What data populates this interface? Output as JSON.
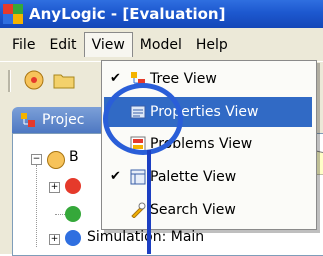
{
  "window": {
    "title": "AnyLogic - [Evaluation]"
  },
  "menubar": {
    "items": [
      "File",
      "Edit",
      "View",
      "Model",
      "Help"
    ],
    "active_index": 2
  },
  "panel": {
    "tab_label": "Projec"
  },
  "tree": {
    "root_label": "B",
    "items": [
      "Simulation: Main"
    ]
  },
  "view_menu": {
    "items": [
      {
        "label": "Tree View",
        "checked": true,
        "icon": "tree-view-icon"
      },
      {
        "label": "Properties View",
        "checked": false,
        "icon": "properties-view-icon",
        "highlighted": true
      },
      {
        "label": "Problems View",
        "checked": false,
        "icon": "problems-view-icon"
      },
      {
        "label": "Palette View",
        "checked": true,
        "icon": "palette-view-icon"
      },
      {
        "label": "Search View",
        "checked": false,
        "icon": "search-view-icon"
      }
    ]
  },
  "colors": {
    "titlebar": "#1d58cf",
    "menu_highlight": "#316ac5",
    "annotation": "#2a5ed8",
    "callout": "#ffffc8"
  }
}
